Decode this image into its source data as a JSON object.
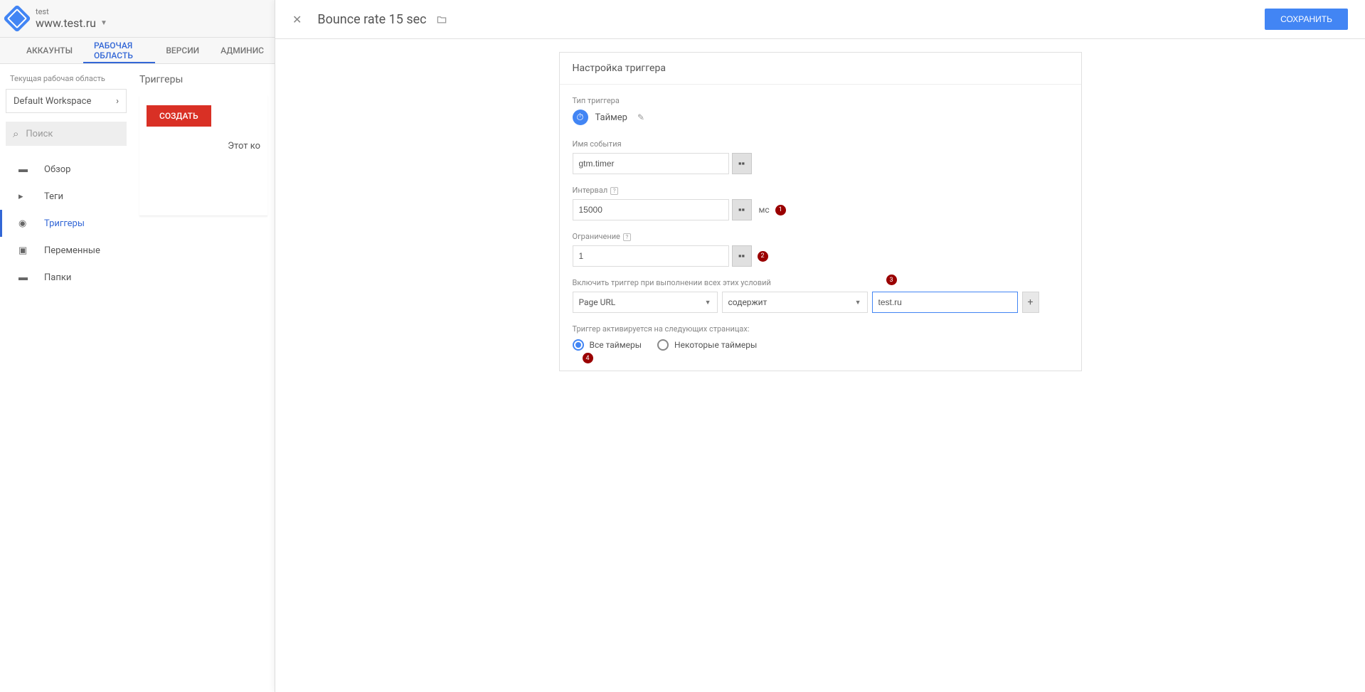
{
  "header": {
    "account": "test",
    "container": "www.test.ru"
  },
  "tabs": {
    "accounts": "АККАУНТЫ",
    "workspace": "РАБОЧАЯ ОБЛАСТЬ",
    "versions": "ВЕРСИИ",
    "admin": "АДМИНИС"
  },
  "sidebar": {
    "workspace_label": "Текущая рабочая область",
    "workspace_name": "Default Workspace",
    "search_placeholder": "Поиск",
    "items": {
      "overview": "Обзор",
      "tags": "Теги",
      "triggers": "Триггеры",
      "variables": "Переменные",
      "folders": "Папки"
    }
  },
  "content": {
    "title": "Триггеры",
    "create_button": "СОЗДАТЬ",
    "empty_text": "Этот ко"
  },
  "overlay": {
    "title": "Bounce rate 15 sec",
    "save_button": "СОХРАНИТЬ"
  },
  "panel": {
    "title": "Настройка триггера",
    "type_label": "Тип триггера",
    "type_value": "Таймер",
    "event_name_label": "Имя события",
    "event_name_value": "gtm.timer",
    "interval_label": "Интервал",
    "interval_value": "15000",
    "ms": "мс",
    "limit_label": "Ограничение",
    "limit_value": "1",
    "conditions_label": "Включить триггер при выполнении всех этих условий",
    "field_select": "Page URL",
    "operator_select": "содержит",
    "value_input": "test.ru",
    "fires_on_label": "Триггер активируется на следующих страницах:",
    "radio_all": "Все таймеры",
    "radio_some": "Некоторые таймеры"
  },
  "badges": {
    "b1": "1",
    "b2": "2",
    "b3": "3",
    "b4": "4"
  }
}
